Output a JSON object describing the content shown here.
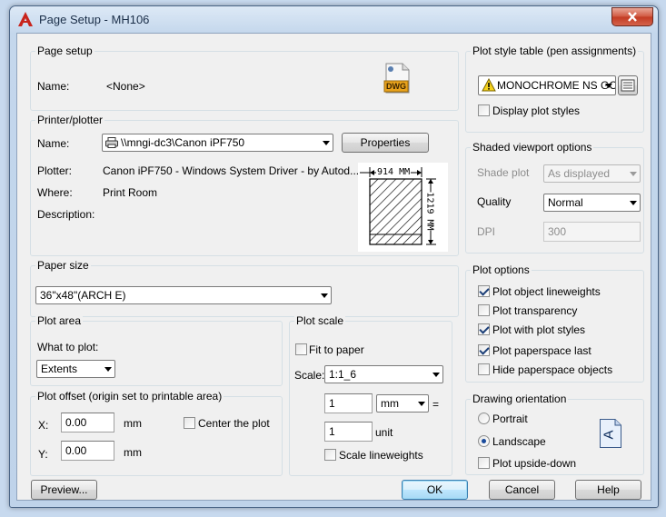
{
  "window": {
    "title": "Page Setup - MH106"
  },
  "page_setup": {
    "group_title": "Page setup",
    "name_label": "Name:",
    "name_value": "<None>",
    "dwg_icon_text": "DWG"
  },
  "printer": {
    "group_title": "Printer/plotter",
    "name_label": "Name:",
    "name_value": "\\\\mngi-dc3\\Canon iPF750",
    "properties_label": "Properties",
    "plotter_label": "Plotter:",
    "plotter_value": "Canon iPF750 - Windows System Driver - by Autod...",
    "where_label": "Where:",
    "where_value": "Print Room",
    "description_label": "Description:",
    "paper_width": "914 MM",
    "paper_height": "1219 MM"
  },
  "paper_size": {
    "group_title": "Paper size",
    "value": "36\"x48\"(ARCH E)"
  },
  "plot_area": {
    "group_title": "Plot area",
    "what_label": "What to plot:",
    "what_value": "Extents"
  },
  "plot_offset": {
    "group_title": "Plot offset (origin set to printable area)",
    "x_label": "X:",
    "x_value": "0.00",
    "x_unit": "mm",
    "y_label": "Y:",
    "y_value": "0.00",
    "y_unit": "mm",
    "center_label": "Center the plot"
  },
  "plot_scale": {
    "group_title": "Plot scale",
    "fit_label": "Fit to paper",
    "scale_label": "Scale:",
    "scale_value": "1:1_6",
    "value1": "1",
    "unit1": "mm",
    "equals": "=",
    "value2": "1",
    "unit2": "unit",
    "lineweights_label": "Scale lineweights"
  },
  "plot_style": {
    "group_title": "Plot style table (pen assignments)",
    "table_value": "MONOCHROME NS GOV",
    "display_label": "Display plot styles"
  },
  "shaded": {
    "group_title": "Shaded viewport options",
    "shade_label": "Shade plot",
    "shade_value": "As displayed",
    "quality_label": "Quality",
    "quality_value": "Normal",
    "dpi_label": "DPI",
    "dpi_value": "300"
  },
  "plot_options": {
    "group_title": "Plot options",
    "items": [
      {
        "label": "Plot object lineweights",
        "checked": true
      },
      {
        "label": "Plot transparency",
        "checked": false
      },
      {
        "label": "Plot with plot styles",
        "checked": true
      },
      {
        "label": "Plot paperspace last",
        "checked": true
      },
      {
        "label": "Hide paperspace objects",
        "checked": false
      }
    ]
  },
  "orientation": {
    "group_title": "Drawing orientation",
    "portrait_label": "Portrait",
    "landscape_label": "Landscape",
    "upside_label": "Plot upside-down",
    "selected": "landscape",
    "icon_letter": "A"
  },
  "footer": {
    "preview_label": "Preview...",
    "ok_label": "OK",
    "cancel_label": "Cancel",
    "help_label": "Help"
  }
}
